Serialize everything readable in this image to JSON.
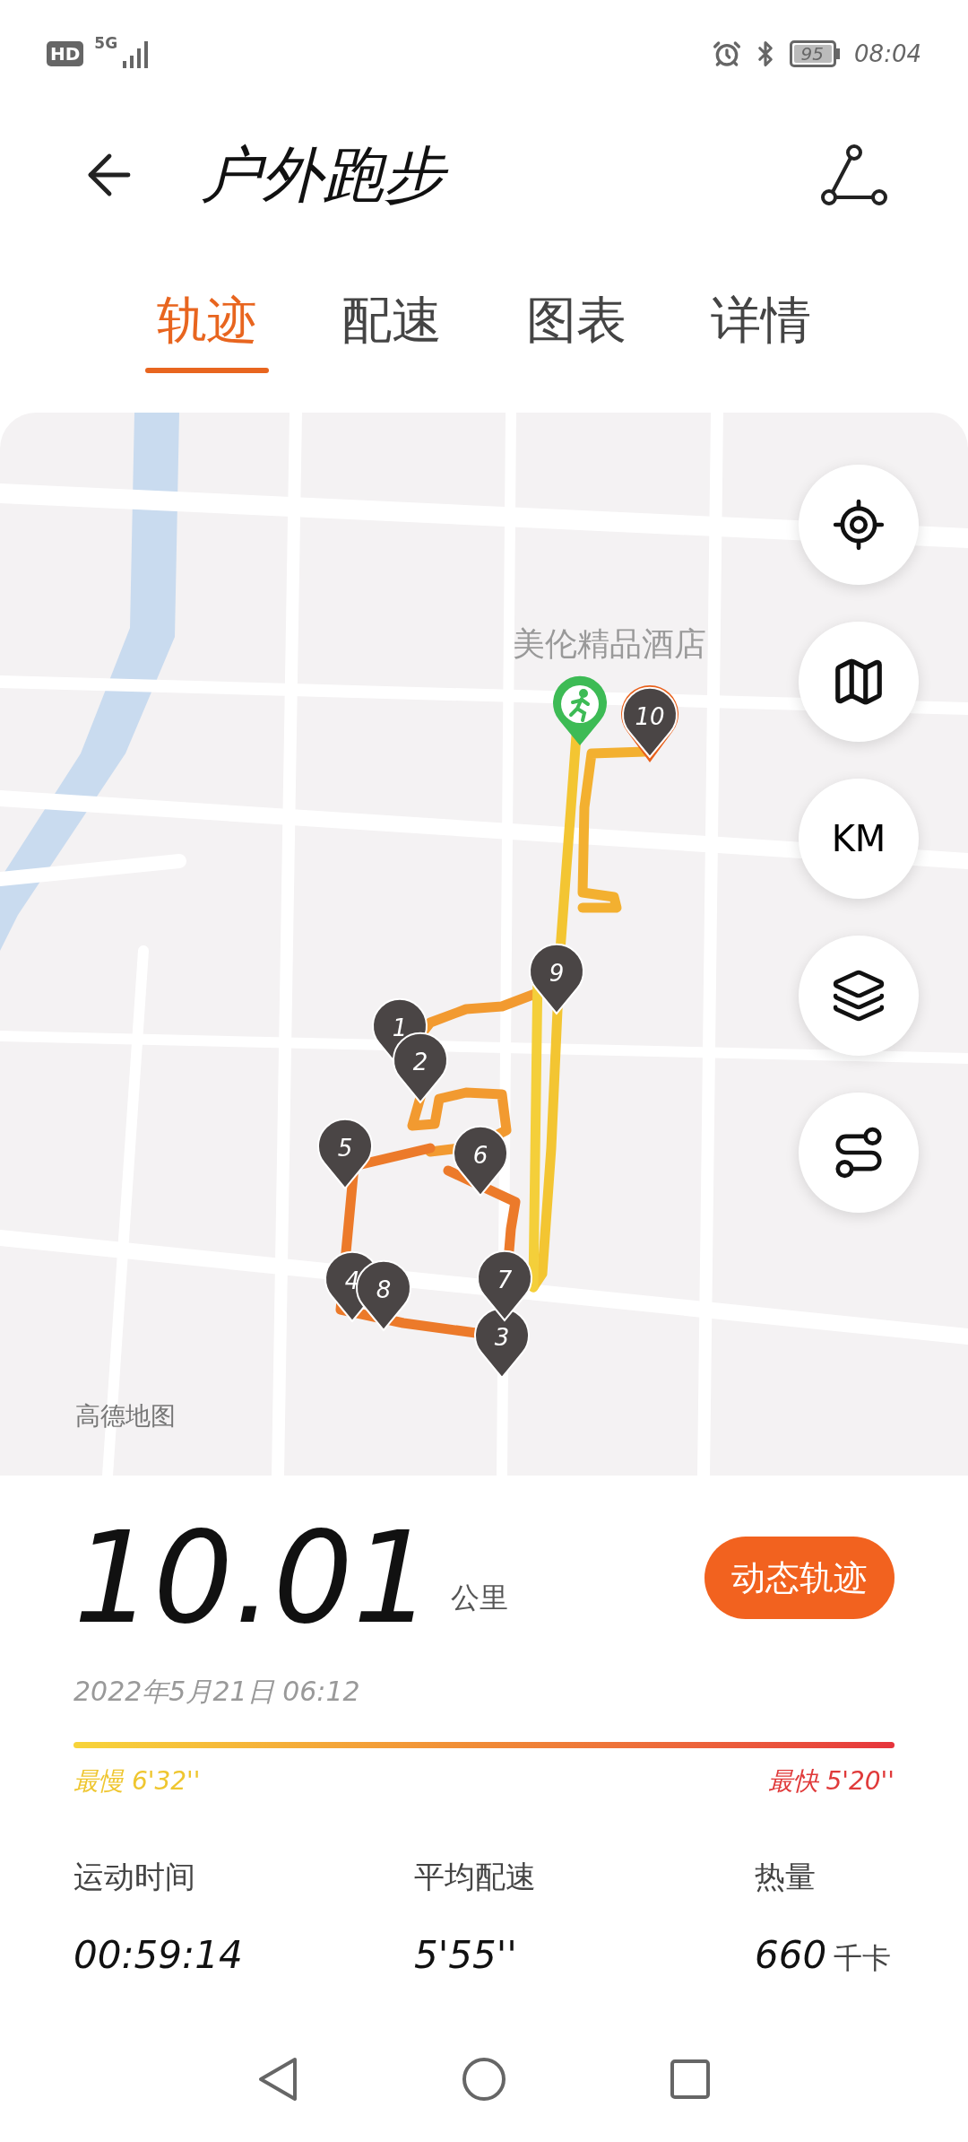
{
  "status_bar": {
    "hd": "HD",
    "network": "5G",
    "battery": "95",
    "time": "08:04"
  },
  "header": {
    "title": "户外跑步"
  },
  "tabs": [
    {
      "label": "轨迹",
      "selected": true
    },
    {
      "label": "配速",
      "selected": false
    },
    {
      "label": "图表",
      "selected": false
    },
    {
      "label": "详情",
      "selected": false
    }
  ],
  "map": {
    "place_label": "美伦精品酒店",
    "attribution": "高德地图",
    "markers": [
      {
        "kind": "start"
      },
      {
        "kind": "split",
        "label": "10"
      },
      {
        "kind": "split",
        "label": "9"
      },
      {
        "kind": "split",
        "label": "1"
      },
      {
        "kind": "split",
        "label": "2"
      },
      {
        "kind": "split",
        "label": "5"
      },
      {
        "kind": "split",
        "label": "6"
      },
      {
        "kind": "split",
        "label": "4"
      },
      {
        "kind": "split",
        "label": "8"
      },
      {
        "kind": "split",
        "label": "3"
      },
      {
        "kind": "split",
        "label": "7"
      }
    ]
  },
  "map_controls": [
    {
      "kind": "locate"
    },
    {
      "kind": "map"
    },
    {
      "kind": "units",
      "label": "KM"
    },
    {
      "kind": "layers"
    },
    {
      "kind": "route"
    }
  ],
  "summary": {
    "distance": "10.01",
    "unit": "公里",
    "replay_button": "动态轨迹",
    "date": "2022年5月21日  06:12",
    "slowest": {
      "label": "最慢",
      "value": "6'32''"
    },
    "fastest": {
      "label": "最快",
      "value": "5'20''"
    }
  },
  "stats": [
    {
      "label": "运动时间",
      "value": "00:59:14"
    },
    {
      "label": "平均配速",
      "value": "5'55''"
    },
    {
      "label": "热量",
      "value": "660",
      "unit": "千卡"
    }
  ]
}
